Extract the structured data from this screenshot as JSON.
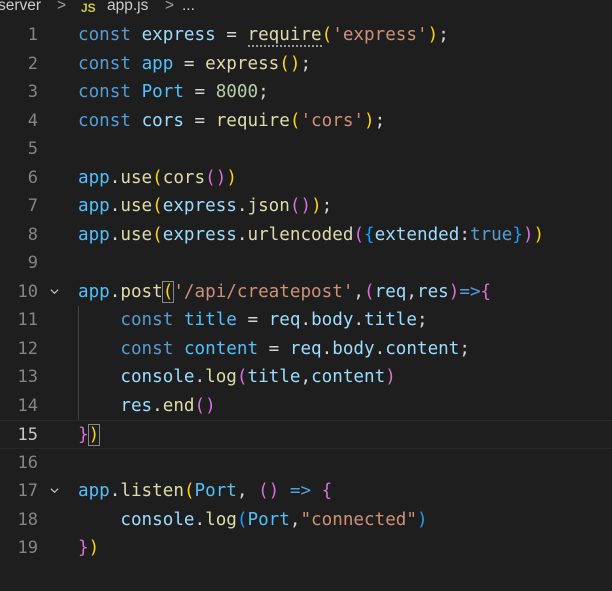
{
  "breadcrumb": {
    "folder": "server",
    "separator": ">",
    "file_badge": "JS",
    "file": "app.js",
    "more": "..."
  },
  "editor": {
    "current_line": 15,
    "lines": [
      {
        "n": "1",
        "tokens": [
          [
            "kw",
            "const"
          ],
          [
            "pun",
            " "
          ],
          [
            "var",
            "express"
          ],
          [
            "pun",
            " = "
          ],
          [
            "fn",
            "require"
          ],
          [
            "br1",
            "("
          ],
          [
            "str",
            "'express'"
          ],
          [
            "br1",
            ")"
          ],
          [
            "pun",
            ";"
          ]
        ]
      },
      {
        "n": "2",
        "tokens": [
          [
            "kw",
            "const"
          ],
          [
            "pun",
            " "
          ],
          [
            "cst",
            "app"
          ],
          [
            "pun",
            " = "
          ],
          [
            "fn",
            "express"
          ],
          [
            "br1",
            "()"
          ],
          [
            "pun",
            ";"
          ]
        ]
      },
      {
        "n": "3",
        "tokens": [
          [
            "kw",
            "const"
          ],
          [
            "pun",
            " "
          ],
          [
            "cst",
            "Port"
          ],
          [
            "pun",
            " = "
          ],
          [
            "num",
            "8000"
          ],
          [
            "pun",
            ";"
          ]
        ]
      },
      {
        "n": "4",
        "tokens": [
          [
            "kw",
            "const"
          ],
          [
            "pun",
            " "
          ],
          [
            "var",
            "cors"
          ],
          [
            "pun",
            " = "
          ],
          [
            "fn",
            "require"
          ],
          [
            "br1",
            "("
          ],
          [
            "str",
            "'cors'"
          ],
          [
            "br1",
            ")"
          ],
          [
            "pun",
            ";"
          ]
        ]
      },
      {
        "n": "5",
        "tokens": []
      },
      {
        "n": "6",
        "tokens": [
          [
            "cst",
            "app"
          ],
          [
            "pun",
            "."
          ],
          [
            "fn",
            "use"
          ],
          [
            "br1",
            "("
          ],
          [
            "fn",
            "cors"
          ],
          [
            "br2",
            "()"
          ],
          [
            "br1",
            ")"
          ]
        ]
      },
      {
        "n": "7",
        "tokens": [
          [
            "cst",
            "app"
          ],
          [
            "pun",
            "."
          ],
          [
            "fn",
            "use"
          ],
          [
            "br1",
            "("
          ],
          [
            "var",
            "express"
          ],
          [
            "pun",
            "."
          ],
          [
            "fn",
            "json"
          ],
          [
            "br2",
            "()"
          ],
          [
            "br1",
            ")"
          ],
          [
            "pun",
            ";"
          ]
        ]
      },
      {
        "n": "8",
        "tokens": [
          [
            "cst",
            "app"
          ],
          [
            "pun",
            "."
          ],
          [
            "fn",
            "use"
          ],
          [
            "br1",
            "("
          ],
          [
            "var",
            "express"
          ],
          [
            "pun",
            "."
          ],
          [
            "fn",
            "urlencoded"
          ],
          [
            "br2",
            "("
          ],
          [
            "br3",
            "{"
          ],
          [
            "var",
            "extended"
          ],
          [
            "pun",
            ":"
          ],
          [
            "kw",
            "true"
          ],
          [
            "br3",
            "}"
          ],
          [
            "br2",
            ")"
          ],
          [
            "br1",
            ")"
          ]
        ]
      },
      {
        "n": "9",
        "tokens": []
      },
      {
        "n": "10",
        "fold": true,
        "tokens": [
          [
            "cst",
            "app"
          ],
          [
            "pun",
            "."
          ],
          [
            "fn",
            "post"
          ],
          [
            "br1",
            "("
          ],
          [
            "str",
            "'/api/createpost'"
          ],
          [
            "pun",
            ","
          ],
          [
            "br2",
            "("
          ],
          [
            "var",
            "req"
          ],
          [
            "pun",
            ","
          ],
          [
            "var",
            "res"
          ],
          [
            "br2",
            ")"
          ],
          [
            "kw",
            "=>"
          ],
          [
            "br2",
            "{"
          ]
        ]
      },
      {
        "n": "11",
        "tokens": [
          [
            "pun",
            "    "
          ],
          [
            "kw",
            "const"
          ],
          [
            "pun",
            " "
          ],
          [
            "cst",
            "title"
          ],
          [
            "pun",
            " = "
          ],
          [
            "var",
            "req"
          ],
          [
            "pun",
            "."
          ],
          [
            "var",
            "body"
          ],
          [
            "pun",
            "."
          ],
          [
            "var",
            "title"
          ],
          [
            "pun",
            ";"
          ]
        ]
      },
      {
        "n": "12",
        "tokens": [
          [
            "pun",
            "    "
          ],
          [
            "kw",
            "const"
          ],
          [
            "pun",
            " "
          ],
          [
            "cst",
            "content"
          ],
          [
            "pun",
            " = "
          ],
          [
            "var",
            "req"
          ],
          [
            "pun",
            "."
          ],
          [
            "var",
            "body"
          ],
          [
            "pun",
            "."
          ],
          [
            "var",
            "content"
          ],
          [
            "pun",
            ";"
          ]
        ]
      },
      {
        "n": "13",
        "tokens": [
          [
            "pun",
            "    "
          ],
          [
            "var",
            "console"
          ],
          [
            "pun",
            "."
          ],
          [
            "fn",
            "log"
          ],
          [
            "br2",
            "("
          ],
          [
            "var",
            "title"
          ],
          [
            "pun",
            ","
          ],
          [
            "var",
            "content"
          ],
          [
            "br2",
            ")"
          ]
        ]
      },
      {
        "n": "14",
        "tokens": [
          [
            "pun",
            "    "
          ],
          [
            "var",
            "res"
          ],
          [
            "pun",
            "."
          ],
          [
            "fn",
            "end"
          ],
          [
            "br2",
            "()"
          ]
        ]
      },
      {
        "n": "15",
        "tokens": [
          [
            "br2",
            "}"
          ],
          [
            "br1",
            ")"
          ]
        ]
      },
      {
        "n": "16",
        "tokens": []
      },
      {
        "n": "17",
        "fold": true,
        "tokens": [
          [
            "cst",
            "app"
          ],
          [
            "pun",
            "."
          ],
          [
            "fn",
            "listen"
          ],
          [
            "br1",
            "("
          ],
          [
            "cst",
            "Port"
          ],
          [
            "pun",
            ", "
          ],
          [
            "br2",
            "()"
          ],
          [
            "pun",
            " "
          ],
          [
            "kw",
            "=>"
          ],
          [
            "pun",
            " "
          ],
          [
            "br2",
            "{"
          ]
        ]
      },
      {
        "n": "18",
        "tokens": [
          [
            "pun",
            "    "
          ],
          [
            "var",
            "console"
          ],
          [
            "pun",
            "."
          ],
          [
            "fn",
            "log"
          ],
          [
            "br3",
            "("
          ],
          [
            "cst",
            "Port"
          ],
          [
            "pun",
            ","
          ],
          [
            "str",
            "\"connected\""
          ],
          [
            "br3",
            ")"
          ]
        ]
      },
      {
        "n": "19",
        "tokens": [
          [
            "br2",
            "}"
          ],
          [
            "br1",
            ")"
          ]
        ]
      }
    ]
  }
}
